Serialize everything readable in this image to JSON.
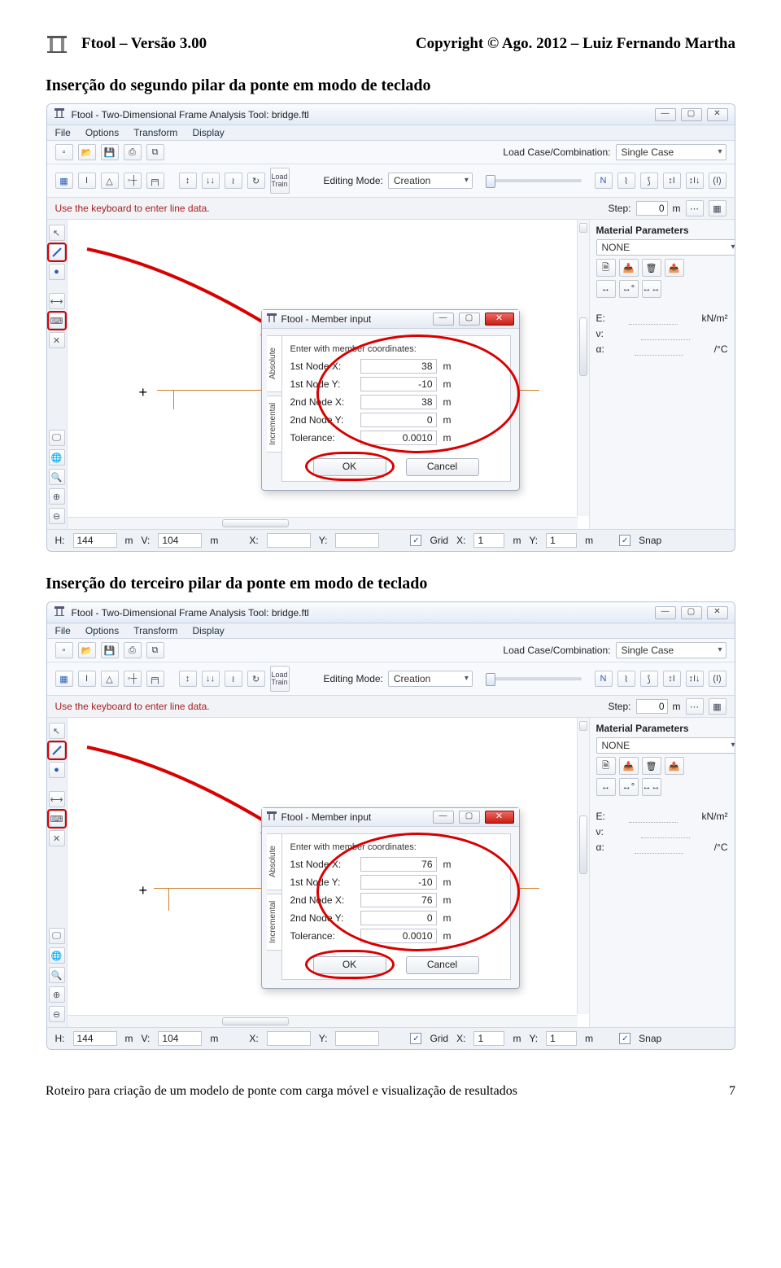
{
  "header": {
    "left": "Ftool – Versão 3.00",
    "right": "Copyright © Ago. 2012 – Luiz Fernando Martha"
  },
  "sections": [
    "Inserção do segundo pilar da ponte em modo de teclado",
    "Inserção do terceiro pilar da ponte em modo de teclado"
  ],
  "appTitle": "Ftool - Two-Dimensional Frame Analysis Tool: bridge.ftl",
  "menus": [
    "File",
    "Options",
    "Transform",
    "Display"
  ],
  "loadCase": {
    "label": "Load Case/Combination:",
    "value": "Single Case"
  },
  "editing": {
    "label": "Editing Mode:",
    "value": "Creation"
  },
  "loadTrainBtn": "Load Train",
  "hint": "Use the keyboard to enter line data.",
  "step": {
    "label": "Step:",
    "value": "0",
    "unit": "m"
  },
  "rightPanel": {
    "title": "Material Parameters",
    "select": "NONE",
    "props": [
      {
        "k": "E:",
        "u": "kN/m²"
      },
      {
        "k": "ν:",
        "u": ""
      },
      {
        "k": "α:",
        "u": "/°C"
      }
    ]
  },
  "dialog": {
    "title": "Ftool - Member input",
    "tab1": "Absolute",
    "tab2": "Incremental",
    "header": "Enter with member coordinates:",
    "rows": [
      "1st Node X:",
      "1st Node Y:",
      "2nd Node X:",
      "2nd Node Y:",
      "Tolerance:"
    ],
    "figs": [
      {
        "vals": [
          "38",
          "-10",
          "38",
          "0",
          "0.0010"
        ]
      },
      {
        "vals": [
          "76",
          "-10",
          "76",
          "0",
          "0.0010"
        ]
      }
    ],
    "unit": "m",
    "ok": "OK",
    "cancel": "Cancel"
  },
  "status": {
    "HLabel": "H:",
    "H": "144",
    "Hunit": "m",
    "VLabel": "V:",
    "V": "104",
    "Vunit": "m",
    "XLabel": "X:",
    "YLabel": "Y:",
    "gridLabel": "Grid",
    "gridX": "X:",
    "gridXval": "1",
    "gridXunit": "m",
    "gridY": "Y:",
    "gridYval": "1",
    "gridYunit": "m",
    "snap": "Snap"
  },
  "footer": {
    "text": "Roteiro para criação de um modelo de ponte com carga móvel e visualização de resultados",
    "page": "7"
  }
}
